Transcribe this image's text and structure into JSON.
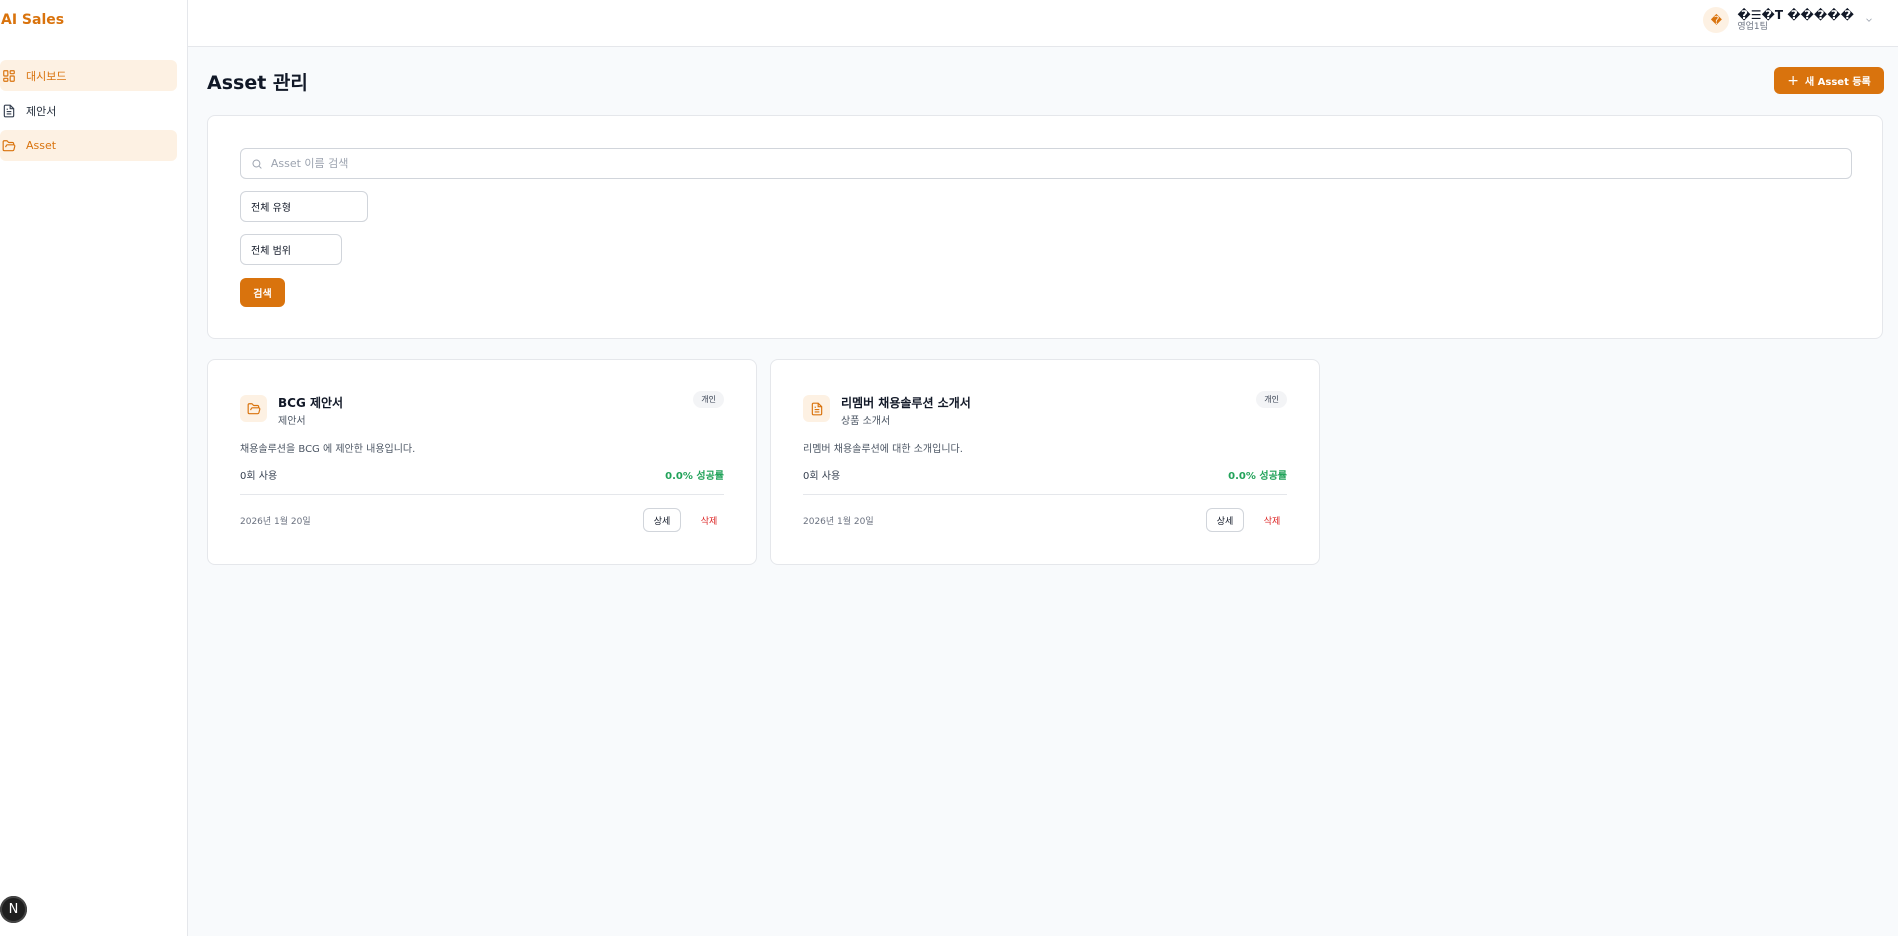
{
  "app": {
    "brand": "AI Sales"
  },
  "sidebar": {
    "items": [
      {
        "label": "대시보드",
        "icon": "dashboard-icon",
        "active": true
      },
      {
        "label": "제안서",
        "icon": "document-icon",
        "active": false
      },
      {
        "label": "Asset",
        "icon": "folder-icon",
        "active": true
      }
    ],
    "bottom_badge": "N"
  },
  "header": {
    "user": {
      "avatar_char": "�",
      "name": "�☰�T �����",
      "team": "영업1팀"
    }
  },
  "main": {
    "title": "Asset 관리",
    "new_button": {
      "icon": "+",
      "label": "새 Asset 등록"
    },
    "filters": {
      "search_placeholder": "Asset 이름 검색",
      "search_value": "",
      "type_select": "전체 유형",
      "scope_select": "전체 범위",
      "search_button": "검색"
    },
    "assets": [
      {
        "icon": "folder-icon",
        "title": "BCG 제안서",
        "subtitle": "제안서",
        "badge": "개인",
        "description": "채용솔루션을 BCG 에 제안한 내용입니다.",
        "usage": "0회 사용",
        "success_rate": "0.0% 성공률",
        "date": "2026년 1월 20일",
        "detail_label": "상세",
        "delete_label": "삭제"
      },
      {
        "icon": "document-icon",
        "title": "리멤버 채용솔루션 소개서",
        "subtitle": "상품 소개서",
        "badge": "개인",
        "description": "리멤버 채용솔루션에 대한 소개입니다.",
        "usage": "0회 사용",
        "success_rate": "0.0% 성공률",
        "date": "2026년 1월 20일",
        "detail_label": "상세",
        "delete_label": "삭제"
      }
    ]
  },
  "colors": {
    "accent": "#d9730d",
    "accent_soft": "#fdf1e3",
    "success": "#22a35a",
    "danger": "#dc2626"
  }
}
